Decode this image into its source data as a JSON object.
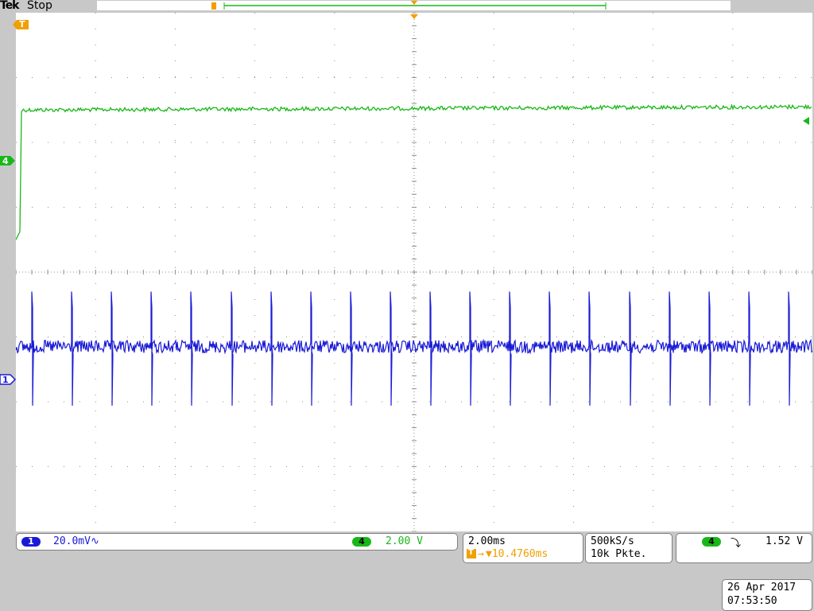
{
  "brand": "Tek",
  "run_state": "Stop",
  "colors": {
    "ch1": "#1a1ad6",
    "ch4": "#18b818",
    "trigger": "#f0a000",
    "grid": "#8c8c8c",
    "background": "#c8c8c8",
    "screen": "#ffffff"
  },
  "markers": {
    "trigger_time": "T",
    "trigger_pos": "T",
    "ch4_ref": "4",
    "ch1_ref": "1"
  },
  "channels": {
    "ch1": {
      "id": "1",
      "scale": "20.0mV∿"
    },
    "ch4": {
      "id": "4",
      "scale": "2.00 V"
    }
  },
  "timebase": {
    "scale": "2.00ms",
    "trigger_offset": "▼10.4760ms"
  },
  "acquisition": {
    "rate": "500kS/s",
    "record_length": "10k Pkte."
  },
  "trigger": {
    "source": "4",
    "slope_icon": "falling-edge-icon",
    "slope_glyph": "⤵",
    "level": "1.52 V"
  },
  "datetime": {
    "date": "26 Apr 2017",
    "time": "07:53:50"
  },
  "chart_data": {
    "type": "line",
    "grid": true,
    "x_divisions": 10,
    "y_divisions": 8,
    "xlim_ms": [
      -10,
      10
    ],
    "series": [
      {
        "name": "4",
        "kind": "step",
        "rise_at_div": 0.05,
        "low_div": 4.5,
        "high_div": 6.5
      },
      {
        "name": "1",
        "kind": "spike_train",
        "baseline_div": 0.5,
        "spike_period_ms": 1.0,
        "first_spike_ms": -9.6,
        "spike_high_div": 1.0,
        "spike_low_div": -1.4
      }
    ]
  }
}
